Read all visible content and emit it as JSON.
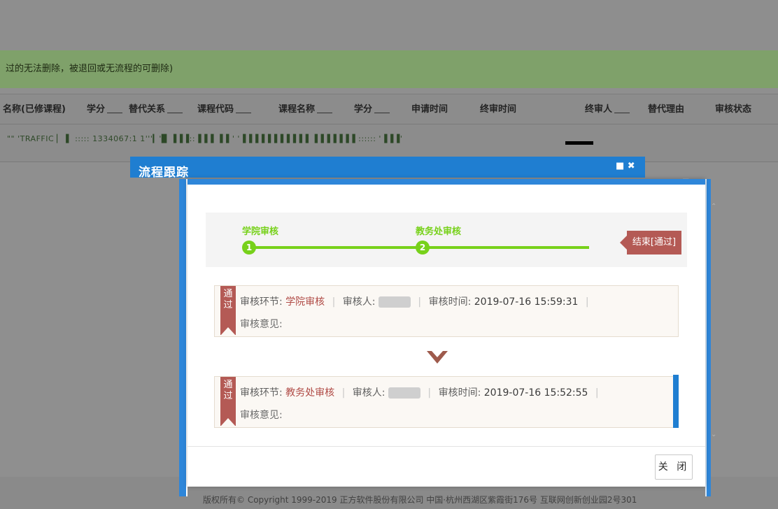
{
  "notice": {
    "text": "过的无法删除，被退回或无流程的可删除)"
  },
  "table": {
    "headers": [
      "名称(已修课程)",
      "学分",
      "替代关系",
      "课程代码",
      "课程名称",
      "学分",
      "申请时间",
      "终审时间",
      "终审人",
      "替代理由",
      "审核状态"
    ],
    "row_text": "\"\" 'TRAFFIC ▏ ▌ ::::: 1334067:1 1'''▎'▉ ▐▐▐::▐▐▐ ▐▐ ' '▐▐▐▐▐▐▐▐▐▐▐ ▐▐▐▐▐▐▐ :::::: '▐▐▐'"
  },
  "footer": {
    "text": "版权所有© Copyright 1999-2019 正方软件股份有限公司    中国·杭州西湖区紫霞街176号 互联网创新创业园2号301"
  },
  "outer_dialog": {
    "title": "流程跟踪",
    "controls": "■ ✖"
  },
  "inner_dialog": {
    "right_controls": "□ ×",
    "steps": [
      {
        "label": "学院审核",
        "number": "1"
      },
      {
        "label": "教务处审核",
        "number": "2"
      }
    ],
    "end_tag": "结束[通过]",
    "records": [
      {
        "badge": "通过",
        "stage_label": "审核环节:",
        "stage": "学院审核",
        "reviewer_label": "审核人:",
        "time_label": "审核时间:",
        "time": "2019-07-16 15:59:31",
        "opinion_label": "审核意见:"
      },
      {
        "badge": "通过",
        "stage_label": "审核环节:",
        "stage": "教务处审核",
        "reviewer_label": "审核人:",
        "time_label": "审核时间:",
        "time": "2019-07-16 15:52:55",
        "opinion_label": "审核意见:"
      }
    ],
    "close_button": "关 闭"
  },
  "colors": {
    "accent_blue": "#1f7ed1",
    "step_green": "#77d11a",
    "badge_red": "#b45a55",
    "notice_green": "#7fa16a"
  },
  "icons": [
    "scroll-up-icon",
    "scroll-down-icon",
    "down-arrow-icon"
  ]
}
